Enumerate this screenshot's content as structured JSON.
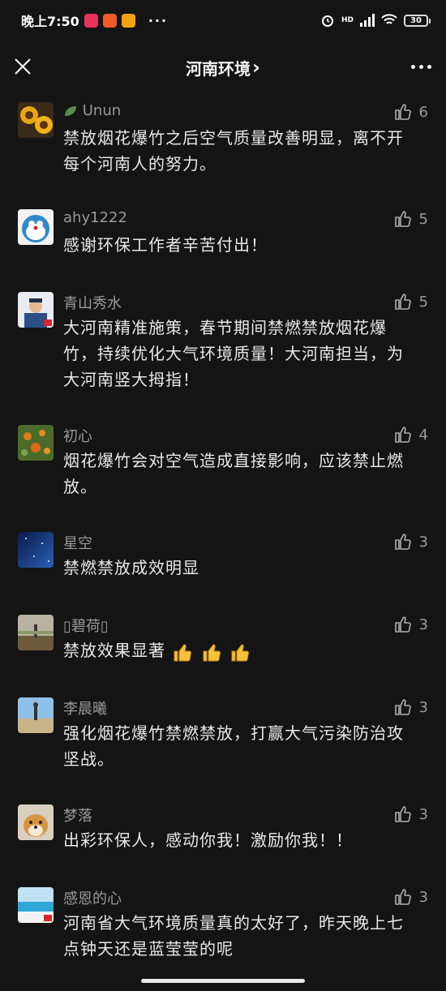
{
  "status_bar": {
    "time": "晚上7:50",
    "dots": "···",
    "network": "HD",
    "battery": "30"
  },
  "nav": {
    "title": "河南环境",
    "chevron": "›"
  },
  "comments": [
    {
      "name": "Unun",
      "name_prefix_icon": "leaf-icon",
      "text": "禁放烟花爆竹之后空气质量改善明显，离不开每个河南人的努力。",
      "likes": "6"
    },
    {
      "name": "ahy1222",
      "text": "感谢环保工作者辛苦付出！",
      "likes": "5"
    },
    {
      "name": "青山秀水",
      "text": "大河南精准施策，春节期间禁燃禁放烟花爆竹，持续优化大气环境质量！大河南担当，为大河南竖大拇指！",
      "likes": "5"
    },
    {
      "name": "初心",
      "text": "烟花爆竹会对空气造成直接影响，应该禁止燃放。",
      "likes": "4"
    },
    {
      "name": "星空",
      "text": "禁燃禁放成效明显",
      "likes": "3"
    },
    {
      "name": "碧荷",
      "name_prefix": "▯",
      "name_suffix": "▯",
      "text": "禁放效果显著",
      "emoji": "thumbs-up-emoji ×3",
      "likes": "3"
    },
    {
      "name": "李晨曦",
      "text": "强化烟花爆竹禁燃禁放，打赢大气污染防治攻坚战。",
      "likes": "3"
    },
    {
      "name": "梦落",
      "text": "出彩环保人，感动你我！激励你我！！",
      "likes": "3"
    },
    {
      "name": "感恩的心",
      "text": "河南省大气环境质量真的太好了，昨天晚上七点钟天还是蓝莹莹的呢",
      "likes": "3"
    }
  ],
  "colors": {
    "background": "#141414",
    "text": "#e8e8e8",
    "secondary": "#9a9a9a"
  }
}
